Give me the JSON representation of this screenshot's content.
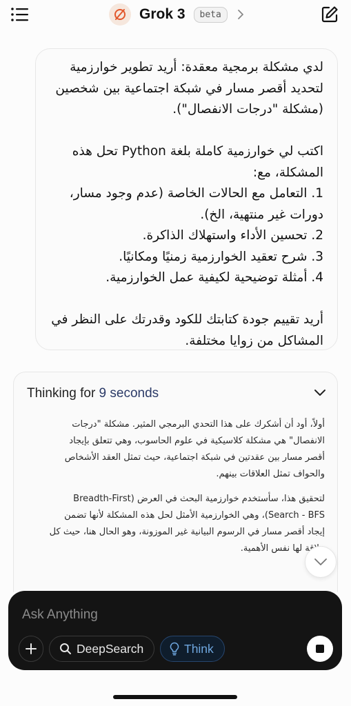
{
  "header": {
    "app_name": "Grok 3",
    "badge": "beta"
  },
  "user_message": {
    "lines": [
      "لدي مشكلة برمجية معقدة: أريد تطوير خوارزمية",
      "لتحديد أقصر مسار في شبكة اجتماعية بين شخصين",
      "(مشكلة \"درجات الانفصال\").",
      "",
      "اكتب لي خوارزمية كاملة بلغة Python تحل هذه",
      "المشكلة، مع:",
      "1. التعامل مع الحالات الخاصة (عدم وجود مسار،",
      "دورات غير منتهية، الخ).",
      "2. تحسين الأداء واستهلاك الذاكرة.",
      "3. شرح تعقيد الخوارزمية زمنيًا ومكانيًا.",
      "4. أمثلة توضيحية لكيفية عمل الخوارزمية.",
      "",
      "أريد تقييم جودة كتابتك للكود وقدرتك على النظر في",
      "المشاكل من زوايا مختلفة."
    ]
  },
  "thinking": {
    "label_prefix": "Thinking for ",
    "duration": "9 seconds",
    "paragraphs": [
      [
        "أولاً، أود أن أشكرك على هذا التحدي البرمجي المثير. مشكلة \"درجات",
        "الانفصال\" هي مشكلة كلاسيكية في علوم الحاسوب، وهي تتعلق بإيجاد",
        "أقصر مسار بين عقدتين في شبكة اجتماعية، حيث تمثل العقد الأشخاص",
        "والحواف تمثل العلاقات بينهم."
      ],
      [
        "لتحقيق هذا، سأستخدم خوارزمية البحث في العرض (Breadth-First",
        "Search - BFS)، وهي الخوارزمية الأمثل لحل هذه المشكلة لأنها تضمن",
        "إيجاد أقصر مسار في الرسوم البيانية غير الموزونة، وهو الحال هنا، حيث كل",
        "علاقة لها نفس الأهمية."
      ]
    ]
  },
  "composer": {
    "placeholder": "Ask Anything",
    "deepsearch_label": "DeepSearch",
    "think_label": "Think"
  },
  "colors": {
    "logo_accent": "#e2572b",
    "think_accent": "#6fa7df",
    "thinking_duration": "#2b3a67"
  },
  "icons": [
    "menu-icon",
    "grok-logo-icon",
    "chevron-right-icon",
    "new-chat-icon",
    "chevron-down-icon",
    "plus-icon",
    "search-icon",
    "lightbulb-icon",
    "stop-icon"
  ]
}
